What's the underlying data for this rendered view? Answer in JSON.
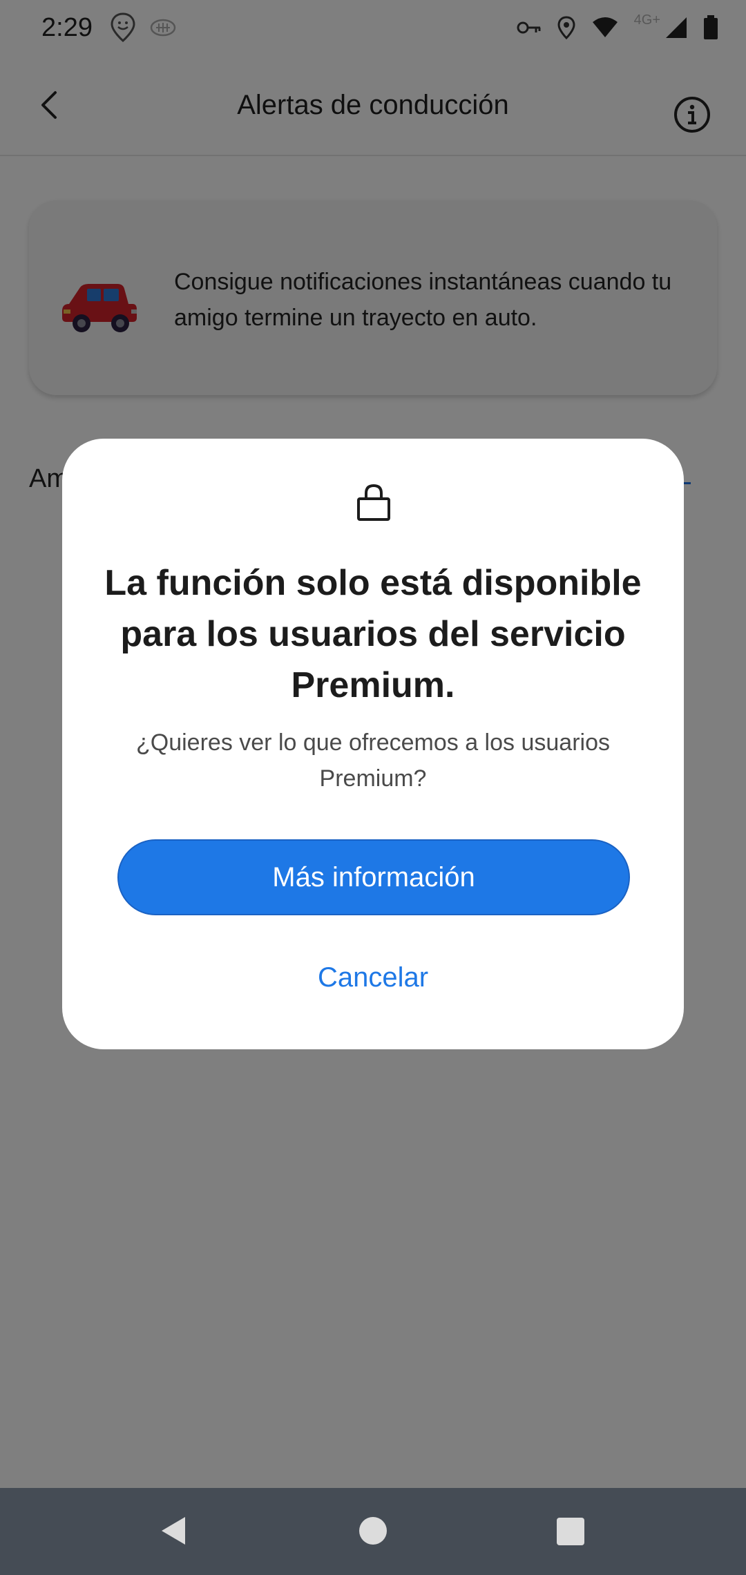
{
  "status_bar": {
    "time": "2:29",
    "network_type": "4G+"
  },
  "app_bar": {
    "title": "Alertas de conducción"
  },
  "intro_card": {
    "text": "Consigue notificaciones instantáneas cuando tu amigo termine un trayecto en auto."
  },
  "section": {
    "label_partial": "Am"
  },
  "dialog": {
    "title": "La función solo está disponible para los usuarios del servicio Premium.",
    "subtitle": "¿Quieres ver lo que ofrecemos a los usuarios Premium?",
    "primary_button": "Más información",
    "cancel_button": "Cancelar"
  },
  "colors": {
    "accent": "#1e78e6",
    "scrim": "rgba(0,0,0,0.5)",
    "nav_bar": "#454c55"
  },
  "icons": [
    "back-arrow-icon",
    "info-icon",
    "car-icon",
    "lock-icon",
    "location-icon",
    "key-icon",
    "wifi-icon",
    "signal-icon",
    "battery-icon"
  ]
}
